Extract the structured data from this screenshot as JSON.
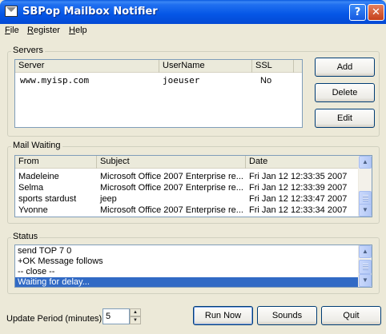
{
  "window": {
    "title": "SBPop Mailbox Notifier",
    "help_glyph": "?",
    "close_glyph": "✕"
  },
  "menu": [
    {
      "accel": "F",
      "rest": "ile"
    },
    {
      "accel": "R",
      "rest": "egister"
    },
    {
      "accel": "H",
      "rest": "elp"
    }
  ],
  "servers": {
    "label": "Servers",
    "columns": [
      "Server",
      "UserName",
      "SSL"
    ],
    "rows": [
      {
        "server": "www.myisp.com",
        "username": "joeuser",
        "ssl": "No"
      }
    ],
    "buttons": {
      "add": "Add",
      "delete": "Delete",
      "edit": "Edit"
    }
  },
  "mail": {
    "label": "Mail Waiting",
    "columns": [
      "From",
      "Subject",
      "Date"
    ],
    "rows": [
      {
        "from": "Madeleine",
        "subject": "Microsoft Office 2007 Enterprise re...",
        "date": "Fri Jan 12 12:33:35 2007"
      },
      {
        "from": "Selma",
        "subject": "Microsoft Office 2007 Enterprise re...",
        "date": "Fri Jan 12 12:33:39 2007"
      },
      {
        "from": "sports stardust",
        "subject": "jeep",
        "date": "Fri Jan 12 12:33:47 2007"
      },
      {
        "from": "Yvonne",
        "subject": "Microsoft Office 2007 Enterprise re...",
        "date": "Fri Jan 12 12:33:34 2007"
      }
    ]
  },
  "status": {
    "label": "Status",
    "lines": [
      "send TOP 7 0",
      "+OK Message follows",
      "-- close --",
      "Waiting for delay..."
    ],
    "selected_index": 3
  },
  "footer": {
    "update_label": "Update Period (minutes):",
    "update_value": "5",
    "run_now": "Run Now",
    "sounds": "Sounds",
    "quit": "Quit"
  },
  "colors": {
    "titlebar": "#0556e6",
    "face": "#ece9d8",
    "selection": "#316ac5"
  }
}
